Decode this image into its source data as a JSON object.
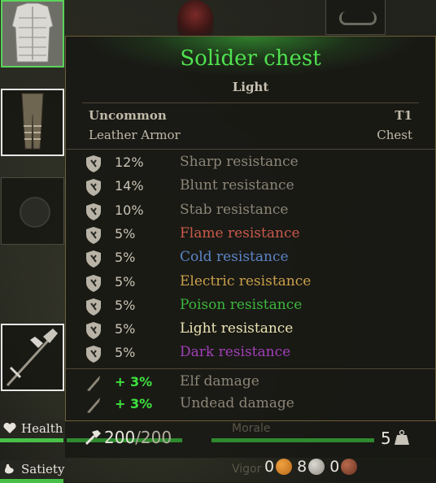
{
  "tooltip": {
    "title": "Solider chest",
    "subtitle": "Light",
    "rarity": "Uncommon",
    "tier": "T1",
    "material": "Leather Armor",
    "slot": "Chest",
    "title_color": "#4fe24f",
    "resistances": [
      {
        "icon": "sharp-shield-icon",
        "value": "12%",
        "label": "Sharp resistance",
        "color": "#8c8677"
      },
      {
        "icon": "blunt-shield-icon",
        "value": "14%",
        "label": "Blunt resistance",
        "color": "#8c8677"
      },
      {
        "icon": "stab-shield-icon",
        "value": "10%",
        "label": "Stab resistance",
        "color": "#8c8677"
      },
      {
        "icon": "flame-shield-icon",
        "value": "5%",
        "label": "Flame resistance",
        "color": "#c95a4a"
      },
      {
        "icon": "cold-shield-icon",
        "value": "5%",
        "label": "Cold resistance",
        "color": "#5b86c8"
      },
      {
        "icon": "electric-shield-icon",
        "value": "5%",
        "label": "Electric resistance",
        "color": "#c9a04a"
      },
      {
        "icon": "poison-shield-icon",
        "value": "5%",
        "label": "Poison resistance",
        "color": "#3cb83c"
      },
      {
        "icon": "light-shield-icon",
        "value": "5%",
        "label": "Light resistance",
        "color": "#ece4b4"
      },
      {
        "icon": "dark-shield-icon",
        "value": "5%",
        "label": "Dark resistance",
        "color": "#a13fb8"
      }
    ],
    "damage_bonuses": [
      {
        "icon": "sword-icon",
        "value": "+ 3%",
        "label": "Elf damage"
      },
      {
        "icon": "sword-icon",
        "value": "+ 3%",
        "label": "Undead damage"
      }
    ],
    "durability": {
      "current": "200",
      "max": "/200"
    },
    "weight": "5"
  },
  "status": {
    "health_label": "Health",
    "satiety_label": "Satiety",
    "morale_label": "Morale",
    "vigor_label": "Vigor"
  },
  "currency": {
    "gold": "0",
    "silver": "8",
    "copper": "0"
  }
}
